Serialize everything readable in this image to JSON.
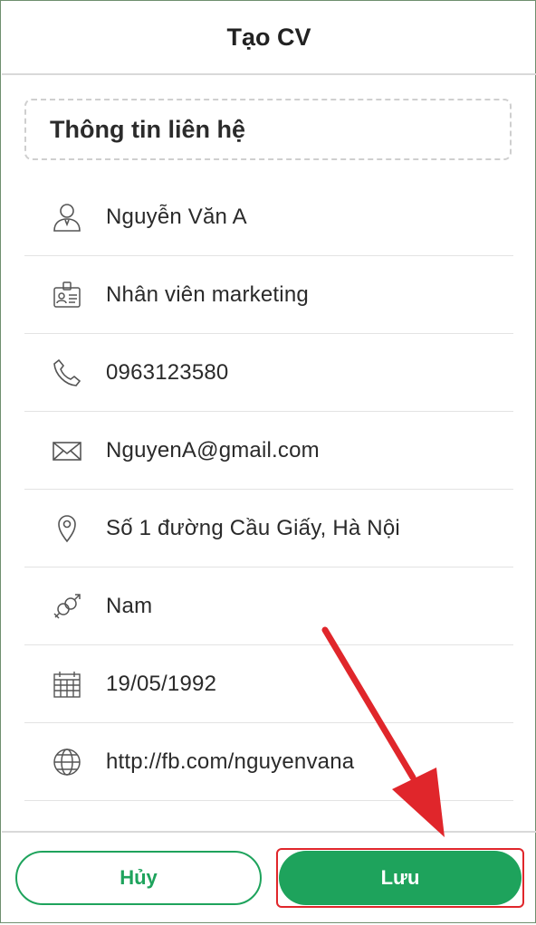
{
  "header": {
    "title": "Tạo CV"
  },
  "section": {
    "title": "Thông tin liên hệ"
  },
  "fields": [
    {
      "icon": "person-icon",
      "value": "Nguyễn Văn A"
    },
    {
      "icon": "id-badge-icon",
      "value": "Nhân viên marketing"
    },
    {
      "icon": "phone-icon",
      "value": "0963123580"
    },
    {
      "icon": "envelope-icon",
      "value": "NguyenA@gmail.com"
    },
    {
      "icon": "location-pin-icon",
      "value": "Số 1 đường Cầu Giấy, Hà Nội"
    },
    {
      "icon": "gender-icon",
      "value": "Nam"
    },
    {
      "icon": "calendar-icon",
      "value": "19/05/1992"
    },
    {
      "icon": "globe-icon",
      "value": "http://fb.com/nguyenvana"
    }
  ],
  "footer": {
    "cancel_label": "Hủy",
    "save_label": "Lưu"
  },
  "colors": {
    "accent": "#1ea35c",
    "annotation": "#e0262b"
  }
}
